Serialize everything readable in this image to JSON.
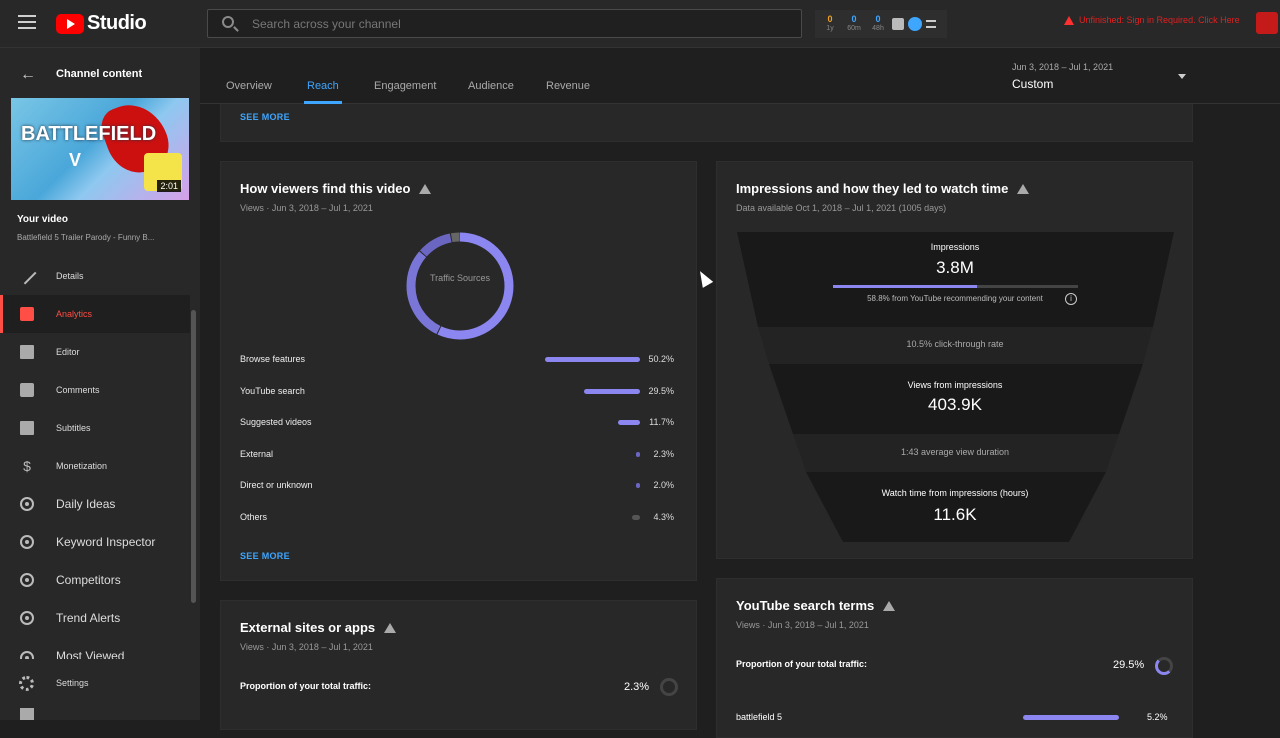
{
  "topbar": {
    "logo_text": "Studio",
    "search_placeholder": "Search across your channel",
    "ext_stats": [
      {
        "value": "0",
        "label": "1y"
      },
      {
        "value": "0",
        "label": "60m"
      },
      {
        "value": "0",
        "label": "48h"
      }
    ],
    "alert_text": "Unfinished: Sign in Required. Click Here"
  },
  "sidebar": {
    "back_label": "←",
    "title": "Channel content",
    "thumb_text": "BATTLEFIELD",
    "thumb_v": "V",
    "duration": "2:01",
    "your_video": "Your video",
    "video_title": "Battlefield 5 Trailer Parody - Funny B...",
    "items": [
      {
        "label": "Details",
        "icon": "pencil-icon"
      },
      {
        "label": "Analytics",
        "icon": "analytics-icon"
      },
      {
        "label": "Editor",
        "icon": "editor-icon"
      },
      {
        "label": "Comments",
        "icon": "comments-icon"
      },
      {
        "label": "Subtitles",
        "icon": "subtitles-icon"
      },
      {
        "label": "Monetization",
        "icon": "dollar-icon"
      },
      {
        "label": "Daily Ideas",
        "icon": "daily-ideas-icon"
      },
      {
        "label": "Keyword Inspector",
        "icon": "keyword-icon"
      },
      {
        "label": "Competitors",
        "icon": "competitors-icon"
      },
      {
        "label": "Trend Alerts",
        "icon": "trend-icon"
      },
      {
        "label": "Most Viewed",
        "icon": "most-viewed-icon"
      }
    ],
    "settings_label": "Settings"
  },
  "tabs": {
    "items": [
      "Overview",
      "Reach",
      "Engagement",
      "Audience",
      "Revenue"
    ],
    "active": "Reach",
    "date_range": "Jun 3, 2018 – Jul 1, 2021",
    "period": "Custom"
  },
  "top_card": {
    "see_more": "SEE MORE"
  },
  "traffic_card": {
    "title": "How viewers find this video",
    "subtitle": "Views · Jun 3, 2018 – Jul 1, 2021",
    "donut_label": "Traffic Sources",
    "rows": [
      {
        "label": "Browse features",
        "pct": 50.2,
        "value": "50.2%"
      },
      {
        "label": "YouTube search",
        "pct": 29.5,
        "value": "29.5%"
      },
      {
        "label": "Suggested videos",
        "pct": 11.7,
        "value": "11.7%"
      },
      {
        "label": "External",
        "pct": 2.3,
        "value": "2.3%"
      },
      {
        "label": "Direct or unknown",
        "pct": 2.0,
        "value": "2.0%"
      },
      {
        "label": "Others",
        "pct": 4.3,
        "value": "4.3%"
      }
    ],
    "see_more": "SEE MORE"
  },
  "impressions_card": {
    "title": "Impressions and how they led to watch time",
    "subtitle": "Data available Oct 1, 2018 – Jul 1, 2021 (1005 days)",
    "impressions_label": "Impressions",
    "impressions_value": "3.8M",
    "impressions_note": "58.8% from YouTube recommending your content",
    "impressions_bar_fraction": 0.588,
    "ctr": "10.5% click-through rate",
    "views_label": "Views from impressions",
    "views_value": "403.9K",
    "avd": "1:43 average view duration",
    "watch_label": "Watch time from impressions (hours)",
    "watch_value": "11.6K"
  },
  "external_card": {
    "title": "External sites or apps",
    "subtitle": "Views · Jun 3, 2018 – Jul 1, 2021",
    "proportion_label": "Proportion of your total traffic:",
    "proportion_value": "2.3%"
  },
  "search_card": {
    "title": "YouTube search terms",
    "subtitle": "Views · Jun 3, 2018 – Jul 1, 2021",
    "proportion_label": "Proportion of your total traffic:",
    "proportion_value": "29.5%",
    "first_term": "battlefield 5",
    "first_value": "5.2%"
  }
}
